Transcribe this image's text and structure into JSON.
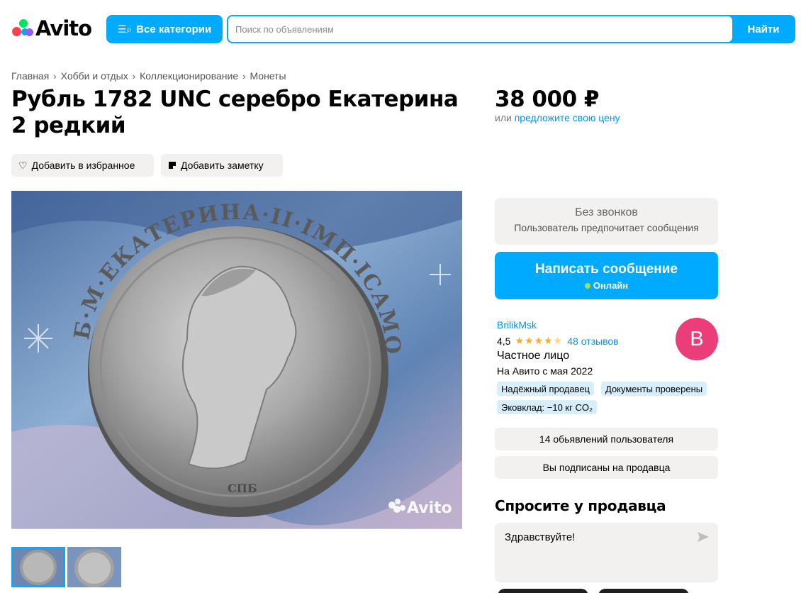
{
  "header": {
    "logo_text": "Avito",
    "categories_label": "Все категории",
    "search_placeholder": "Поиск по объявлениям",
    "search_button": "Найти"
  },
  "breadcrumb": [
    "Главная",
    "Хобби и отдых",
    "Коллекционирование",
    "Монеты"
  ],
  "listing": {
    "title": "Рубль 1782 UNC серебро Екатерина 2 редкий",
    "price": "38 000 ₽",
    "offer_prefix": "или",
    "offer_link": "предложите свою цену",
    "favorite_label": "Добавить в избранное",
    "note_label": "Добавить заметку",
    "image_watermark": "Avito",
    "coin_inscription": "Б·М·ЕКАТЕРИНА·II·IМП·IСАМОДЕРЖ·ВСЕРОСС·",
    "coin_mint": "СПБ"
  },
  "contact": {
    "no_calls_title": "Без звонков",
    "no_calls_subtitle": "Пользователь предпочитает сообщения",
    "message_button": "Написать сообщение",
    "online_label": "Онлайн"
  },
  "seller": {
    "name": "BrilikMsk",
    "rating": "4,5",
    "stars": 4.5,
    "reviews": "48 отзывов",
    "type": "Частное лицо",
    "since": "На Авито с мая 2022",
    "avatar_letter": "B",
    "badges": [
      "Надёжный продавец",
      "Документы проверены",
      "Эковклад: −10 кг CO₂"
    ],
    "ads_button": "14 обьявлений пользователя",
    "subscribe_button": "Вы подписаны на продавца"
  },
  "ask": {
    "title": "Спросите у продавца",
    "message": "Здравствуйте!"
  },
  "colors": {
    "accent": "#00AAFF",
    "link": "#0098EE",
    "avatar": "#EA3D7A",
    "chip_bg": "#F2F1F0",
    "badge_bg": "#D7EEFD",
    "star": "#FFA928",
    "online": "#97E05A"
  },
  "icons": {
    "categories": "filter-search-icon",
    "favorite": "heart-icon",
    "note": "note-icon",
    "send": "send-icon"
  }
}
